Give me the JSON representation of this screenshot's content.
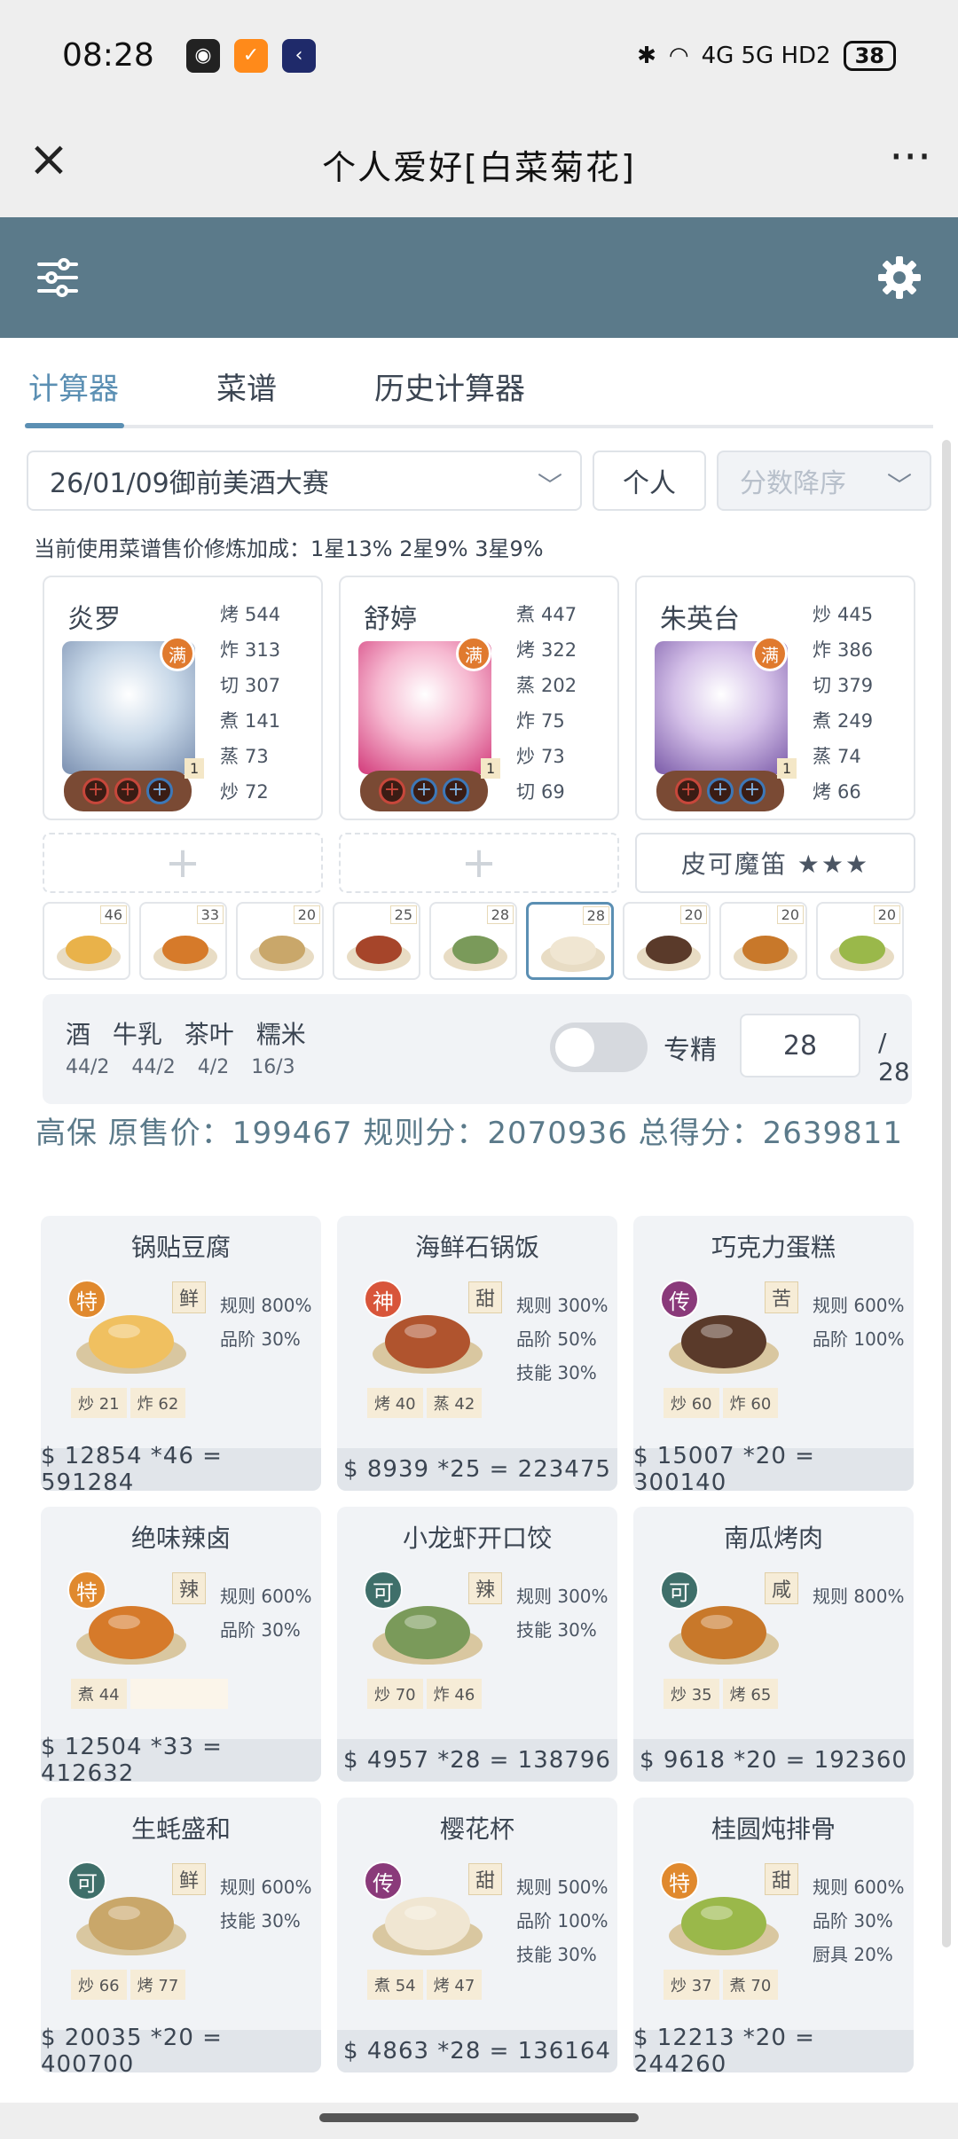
{
  "status": {
    "time": "08:28",
    "battery": "38",
    "network": "4G 5G HD2"
  },
  "window": {
    "title": "个人爱好[白菜菊花]"
  },
  "tabs": [
    "计算器",
    "菜谱",
    "历史计算器"
  ],
  "filters": {
    "event": "26/01/09御前美酒大赛",
    "mode": "个人",
    "sort": "分数降序"
  },
  "hint": "当前使用菜谱售价修炼加成：1星13% 2星9% 3星9%",
  "chefs": [
    {
      "name": "炎罗",
      "badge": "满",
      "level": "1",
      "skills": [
        [
          "烤",
          "544"
        ],
        [
          "炸",
          "313"
        ],
        [
          "切",
          "307"
        ],
        [
          "煮",
          "141"
        ],
        [
          "蒸",
          "73"
        ],
        [
          "炒",
          "72"
        ]
      ],
      "portrait_color": "#c8d8e8"
    },
    {
      "name": "舒婷",
      "badge": "满",
      "level": "1",
      "skills": [
        [
          "煮",
          "447"
        ],
        [
          "烤",
          "322"
        ],
        [
          "蒸",
          "202"
        ],
        [
          "炸",
          "75"
        ],
        [
          "炒",
          "73"
        ],
        [
          "切",
          "69"
        ]
      ],
      "portrait_color": "#f6b8d0"
    },
    {
      "name": "朱英台",
      "badge": "满",
      "level": "1",
      "skills": [
        [
          "炒",
          "445"
        ],
        [
          "炸",
          "386"
        ],
        [
          "切",
          "379"
        ],
        [
          "煮",
          "249"
        ],
        [
          "蒸",
          "74"
        ],
        [
          "烤",
          "66"
        ]
      ],
      "portrait_color": "#d4c0e8"
    }
  ],
  "equip": {
    "empty1": "+",
    "empty2": "+",
    "item": "皮可魔笛 ★★★"
  },
  "recipe_strip": [
    {
      "qty": "46",
      "color": "#e9b24a"
    },
    {
      "qty": "33",
      "color": "#d67a2a"
    },
    {
      "qty": "20",
      "color": "#c9a76a"
    },
    {
      "qty": "25",
      "color": "#a6452a"
    },
    {
      "qty": "28",
      "color": "#7a9a5a"
    },
    {
      "qty": "28",
      "color": "#f0e6d2"
    },
    {
      "qty": "20",
      "color": "#5a3a2a"
    },
    {
      "qty": "20",
      "color": "#c8782a"
    },
    {
      "qty": "20",
      "color": "#9ab84a"
    }
  ],
  "materials": {
    "names": "酒 牛乳 茶叶 糯米",
    "values": "44/2 44/2 4/2 16/3",
    "toggle_label": "专精",
    "input": "28",
    "total": "/ 28"
  },
  "summary": "高保 原售价：199467 规则分：2070936 总得分：2639811",
  "dishes": [
    {
      "name": "锅贴豆腐",
      "rank": "特",
      "rank_color": "#e0892e",
      "flavor": "鲜",
      "rules": [
        "规则 800%",
        "品阶 30%"
      ],
      "skills": [
        [
          "炒",
          "21"
        ],
        [
          "炸",
          "62"
        ]
      ],
      "foot": "$ 12854 *46 = 591284",
      "color": "#f0c060"
    },
    {
      "name": "海鲜石锅饭",
      "rank": "神",
      "rank_color": "#d8553a",
      "flavor": "甜",
      "rules": [
        "规则 300%",
        "品阶 50%",
        "技能 30%"
      ],
      "skills": [
        [
          "烤",
          "40"
        ],
        [
          "蒸",
          "42"
        ]
      ],
      "foot": "$ 8939 *25 = 223475",
      "color": "#b0542e"
    },
    {
      "name": "巧克力蛋糕",
      "rank": "传",
      "rank_color": "#8a3a7a",
      "flavor": "苦",
      "rules": [
        "规则 600%",
        "品阶 100%"
      ],
      "skills": [
        [
          "炒",
          "60"
        ],
        [
          "炸",
          "60"
        ]
      ],
      "foot": "$ 15007 *20 = 300140",
      "color": "#5a3a2a"
    },
    {
      "name": "绝味辣卤",
      "rank": "特",
      "rank_color": "#e0892e",
      "flavor": "辣",
      "rules": [
        "规则 600%",
        "品阶 30%"
      ],
      "skills": [
        [
          "煮",
          "44"
        ]
      ],
      "foot": "$ 12504 *33 = 412632",
      "color": "#d67a2a"
    },
    {
      "name": "小龙虾开口饺",
      "rank": "可",
      "rank_color": "#3f6f6a",
      "flavor": "辣",
      "rules": [
        "规则 300%",
        "技能 30%"
      ],
      "skills": [
        [
          "炒",
          "70"
        ],
        [
          "炸",
          "46"
        ]
      ],
      "foot": "$ 4957 *28 = 138796",
      "color": "#7a9a5a"
    },
    {
      "name": "南瓜烤肉",
      "rank": "可",
      "rank_color": "#3f6f6a",
      "flavor": "咸",
      "rules": [
        "规则 800%"
      ],
      "skills": [
        [
          "炒",
          "35"
        ],
        [
          "烤",
          "65"
        ]
      ],
      "foot": "$ 9618 *20 = 192360",
      "color": "#c8782a"
    },
    {
      "name": "生蚝盛和",
      "rank": "可",
      "rank_color": "#3f6f6a",
      "flavor": "鲜",
      "rules": [
        "规则 600%",
        "技能 30%"
      ],
      "skills": [
        [
          "炒",
          "66"
        ],
        [
          "烤",
          "77"
        ]
      ],
      "foot": "$ 20035 *20 = 400700",
      "color": "#c9a76a"
    },
    {
      "name": "樱花杯",
      "rank": "传",
      "rank_color": "#8a3a7a",
      "flavor": "甜",
      "rules": [
        "规则 500%",
        "品阶 100%",
        "技能 30%"
      ],
      "skills": [
        [
          "煮",
          "54"
        ],
        [
          "烤",
          "47"
        ]
      ],
      "foot": "$ 4863 *28 = 136164",
      "color": "#f0e6d2"
    },
    {
      "name": "桂圆炖排骨",
      "rank": "特",
      "rank_color": "#e0892e",
      "flavor": "甜",
      "rules": [
        "规则 600%",
        "品阶 30%",
        "厨具 20%"
      ],
      "skills": [
        [
          "炒",
          "37"
        ],
        [
          "煮",
          "70"
        ]
      ],
      "foot": "$ 12213 *20 = 244260",
      "color": "#9ab84a"
    }
  ]
}
